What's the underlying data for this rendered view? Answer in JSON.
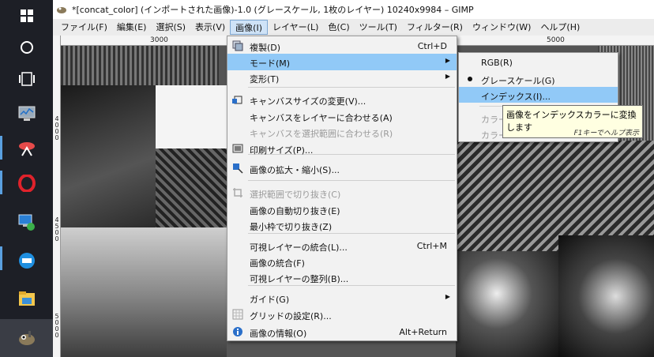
{
  "window": {
    "title": "*[concat_color] (インポートされた画像)-1.0 (グレースケール, 1枚のレイヤー) 10240x9984 – GIMP"
  },
  "menubar": [
    "ファイル(F)",
    "編集(E)",
    "選択(S)",
    "表示(V)",
    "画像(I)",
    "レイヤー(L)",
    "色(C)",
    "ツール(T)",
    "フィルター(R)",
    "ウィンドウ(W)",
    "ヘルプ(H)"
  ],
  "ruler": {
    "top": [
      "3000",
      "5000"
    ],
    "left": [
      "4000",
      "4500",
      "5000"
    ]
  },
  "image_menu": {
    "items": [
      {
        "label": "複製(D)",
        "shortcut": "Ctrl+D",
        "icon": "duplicate-icon"
      },
      {
        "label": "モード(M)",
        "submenu": true
      },
      {
        "label": "変形(T)",
        "submenu": true
      },
      {
        "label": "キャンバスサイズの変更(V)...",
        "icon": "canvas-size-icon"
      },
      {
        "label": "キャンバスをレイヤーに合わせる(A)"
      },
      {
        "label": "キャンバスを選択範囲に合わせる(R)",
        "disabled": true
      },
      {
        "label": "印刷サイズ(P)...",
        "icon": "print-size-icon"
      },
      {
        "label": "画像の拡大・縮小(S)...",
        "icon": "scale-icon"
      },
      {
        "label": "選択範囲で切り抜き(C)",
        "disabled": true,
        "icon": "crop-icon"
      },
      {
        "label": "画像の自動切り抜き(E)"
      },
      {
        "label": "最小枠で切り抜き(Z)"
      },
      {
        "label": "可視レイヤーの統合(L)...",
        "shortcut": "Ctrl+M"
      },
      {
        "label": "画像の統合(F)"
      },
      {
        "label": "可視レイヤーの整列(B)..."
      },
      {
        "label": "ガイド(G)",
        "submenu": true
      },
      {
        "label": "グリッドの設定(R)...",
        "icon": "grid-icon"
      },
      {
        "label": "画像の情報(O)",
        "shortcut": "Alt+Return",
        "icon": "info-icon"
      }
    ]
  },
  "mode_menu": {
    "items": [
      {
        "label": "RGB(R)"
      },
      {
        "label": "グレースケール(G)",
        "checked": true
      },
      {
        "label": "インデックス(I)..."
      },
      {
        "label": "カラー"
      },
      {
        "label": "カラー"
      }
    ]
  },
  "tooltip": {
    "text": "画像をインデックスカラーに変換します",
    "hint": "F1キーでヘルプ表示"
  },
  "colors": {
    "highlight": "#91c9f7",
    "menu_bg": "#f2f2f2",
    "tooltip_bg": "#ffffe1",
    "taskbar": "#1d1f26"
  }
}
